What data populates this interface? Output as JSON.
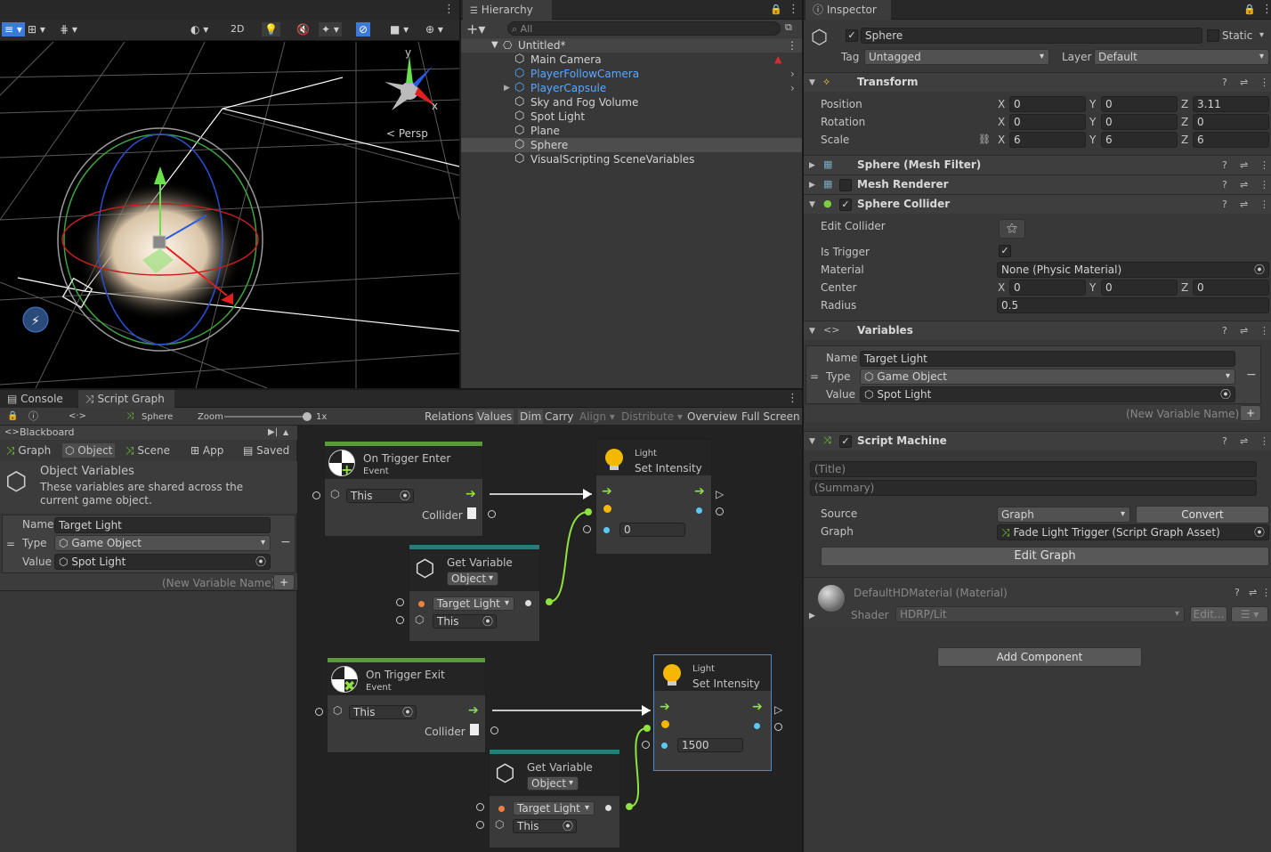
{
  "scene": {
    "toolbar": {
      "btn_2d": "2D",
      "persp_label": "< Persp",
      "axis_y": "y",
      "axis_x": "x"
    }
  },
  "hierarchy": {
    "tab_label": "Hierarchy",
    "search_placeholder": "All",
    "scene_name": "Untitled*",
    "items": [
      {
        "label": "Main Camera",
        "type": "cube",
        "color": "#d2d2d2"
      },
      {
        "label": "PlayerFollowCamera",
        "type": "prefab",
        "color": "#5aa8ff"
      },
      {
        "label": "PlayerCapsule",
        "type": "prefab",
        "color": "#5aa8ff"
      },
      {
        "label": "Sky and Fog Volume",
        "type": "cube",
        "color": "#d2d2d2"
      },
      {
        "label": "Spot Light",
        "type": "cube",
        "color": "#d2d2d2"
      },
      {
        "label": "Plane",
        "type": "cube",
        "color": "#d2d2d2"
      },
      {
        "label": "Sphere",
        "type": "cube",
        "color": "#d2d2d2"
      },
      {
        "label": "VisualScripting SceneVariables",
        "type": "cube",
        "color": "#d2d2d2"
      }
    ]
  },
  "inspector": {
    "tab_label": "Inspector",
    "object_name": "Sphere",
    "static_label": "Static",
    "tag_label": "Tag",
    "tag_value": "Untagged",
    "layer_label": "Layer",
    "layer_value": "Default",
    "transform": {
      "title": "Transform",
      "position_label": "Position",
      "rotation_label": "Rotation",
      "scale_label": "Scale",
      "position": [
        "0",
        "0",
        "3.11"
      ],
      "rotation": [
        "0",
        "0",
        "0"
      ],
      "scale": [
        "6",
        "6",
        "6"
      ]
    },
    "mesh_filter_title": "Sphere (Mesh Filter)",
    "mesh_renderer_title": "Mesh Renderer",
    "collider": {
      "title": "Sphere Collider",
      "edit_collider_label": "Edit Collider",
      "is_trigger_label": "Is Trigger",
      "material_label": "Material",
      "material_value": "None (Physic Material)",
      "center_label": "Center",
      "center": [
        "0",
        "0",
        "0"
      ],
      "radius_label": "Radius",
      "radius_value": "0.5"
    },
    "variables": {
      "title": "Variables",
      "name_label": "Name",
      "name_value": "Target Light",
      "type_label": "Type",
      "type_value": "Game Object",
      "value_label": "Value",
      "value_value": "Spot Light",
      "new_var_placeholder": "(New Variable Name)"
    },
    "script_machine": {
      "title": "Script Machine",
      "title_placeholder": "(Title)",
      "summary_placeholder": "(Summary)",
      "source_label": "Source",
      "source_value": "Graph",
      "convert_label": "Convert",
      "graph_label": "Graph",
      "graph_value": "Fade Light Trigger (Script Graph Asset)",
      "edit_graph_label": "Edit Graph"
    },
    "material": {
      "title": "DefaultHDMaterial (Material)",
      "shader_label": "Shader",
      "shader_value": "HDRP/Lit",
      "edit_label": "Edit..."
    },
    "add_component_label": "Add Component",
    "axis_labels": [
      "X",
      "Y",
      "Z"
    ]
  },
  "graph": {
    "tabs": {
      "console": "Console",
      "script_graph": "Script Graph"
    },
    "toolbar": {
      "context": "Sphere",
      "zoom_label": "Zoom",
      "zoom_value": "1x",
      "relations": "Relations",
      "values": "Values",
      "dim": "Dim",
      "carry": "Carry",
      "align": "Align",
      "distribute": "Distribute",
      "overview": "Overview",
      "full_screen": "Full Screen"
    },
    "blackboard": {
      "title": "Blackboard",
      "tabs": [
        "Graph",
        "Object",
        "Scene",
        "App",
        "Saved"
      ],
      "section_title": "Object Variables",
      "section_desc": "These variables are shared across the current game object.",
      "name_label": "Name",
      "name_value": "Target Light",
      "type_label": "Type",
      "type_value": "Game Object",
      "value_label": "Value",
      "value_value": "Spot Light",
      "new_var_placeholder": "(New Variable Name)"
    },
    "nodes": {
      "trigger_enter": {
        "title": "On Trigger Enter",
        "subtitle": "Event",
        "this_label": "This",
        "collider_label": "Collider"
      },
      "trigger_exit": {
        "title": "On Trigger Exit",
        "subtitle": "Event",
        "this_label": "This",
        "collider_label": "Collider"
      },
      "get_var_1": {
        "title": "Get Variable",
        "kind": "Object",
        "var_name": "Target Light",
        "this_label": "This"
      },
      "get_var_2": {
        "title": "Get Variable",
        "kind": "Object",
        "var_name": "Target Light",
        "this_label": "This"
      },
      "set_int_1": {
        "category": "Light",
        "title": "Set Intensity",
        "value": "0"
      },
      "set_int_2": {
        "category": "Light",
        "title": "Set Intensity",
        "value": "1500"
      }
    }
  },
  "colors": {
    "flow_green": "#8fe33c",
    "selection_blue": "#5aa8ff",
    "light_yellow": "#f5b800"
  }
}
